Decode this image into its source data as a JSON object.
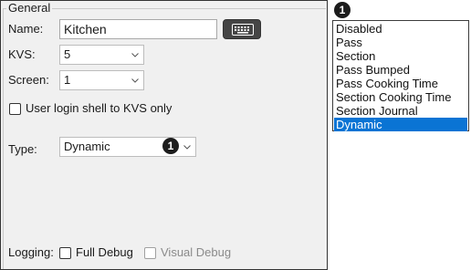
{
  "group": {
    "legend": "General"
  },
  "name": {
    "label": "Name:",
    "value": "Kitchen"
  },
  "keyboard_button": {
    "icon": "keyboard-icon"
  },
  "kvs": {
    "label": "KVS:",
    "value": "5"
  },
  "screen": {
    "label": "Screen:",
    "value": "1"
  },
  "login_shell": {
    "label": "User login shell to KVS only",
    "checked": false
  },
  "type": {
    "label": "Type:",
    "value": "Dynamic"
  },
  "callout": {
    "number": "1"
  },
  "logging": {
    "label": "Logging:",
    "full_debug": {
      "label": "Full Debug",
      "checked": false
    },
    "visual_debug": {
      "label": "Visual Debug",
      "checked": false,
      "disabled": true
    }
  },
  "type_options": {
    "items": [
      "Disabled",
      "Pass",
      "Section",
      "Pass Bumped",
      "Pass Cooking Time",
      "Section Cooking Time",
      "Section Journal",
      "Dynamic"
    ],
    "selected": "Dynamic",
    "selected_color": "#0a74d4"
  }
}
